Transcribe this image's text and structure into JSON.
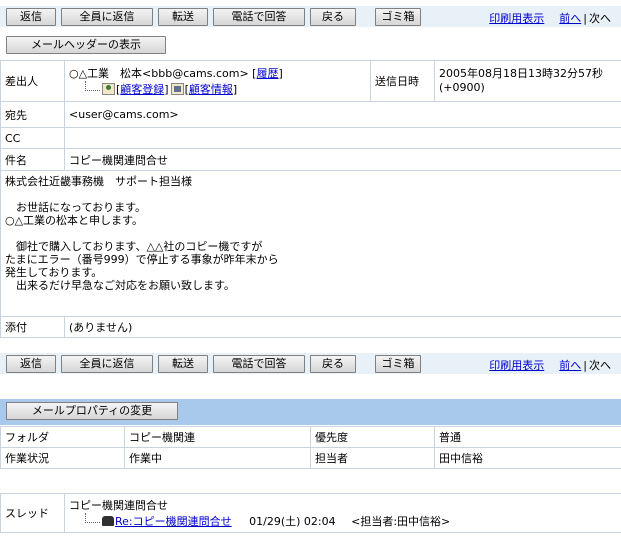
{
  "toolbar": {
    "reply": "返信",
    "reply_all": "全員に返信",
    "forward": "転送",
    "phone_reply": "電話で回答",
    "back": "戻る",
    "trash": "ゴミ箱",
    "print_view": "印刷用表示",
    "prev": "前へ",
    "next": "次へ",
    "separator": "|"
  },
  "header_toggle": "メールヘッダーの表示",
  "mail": {
    "from_label": "差出人",
    "from_value": "○△工業　松本<bbb@cams.com>",
    "history_link": "履歴",
    "customer_register": "顧客登録",
    "customer_info": "顧客情報",
    "sent_label": "送信日時",
    "sent_value_line1": "2005年08月18日13時32分57秒",
    "sent_value_line2": "(+0900)",
    "to_label": "宛先",
    "to_value": "<user@cams.com>",
    "cc_label": "CC",
    "cc_value": "",
    "subject_label": "件名",
    "subject_value": "コピー機関連問合せ",
    "body": "株式会社近畿事務機　サポート担当様\n\n　お世話になっております。\n○△工業の松本と申します。\n\n　御社で購入しております、△△社のコピー機ですが\nたまにエラー（番号999）で停止する事象が昨年末から\n発生しております。\n　出来るだけ早急なご対応をお願い致します。",
    "attach_label": "添付",
    "attach_value": "(ありません)"
  },
  "properties": {
    "change_button": "メールプロパティの変更",
    "folder_label": "フォルダ",
    "folder_value": "コピー機関連",
    "priority_label": "優先度",
    "priority_value": "普通",
    "status_label": "作業状況",
    "status_value": "作業中",
    "assignee_label": "担当者",
    "assignee_value": "田中信裕"
  },
  "thread": {
    "label": "スレッド",
    "root": "コピー機関連問合せ",
    "child_link": "Re:コピー機関連問合せ",
    "child_date": "01/29(土) 02:04",
    "child_assignee": "<担当者:田中信裕>"
  }
}
